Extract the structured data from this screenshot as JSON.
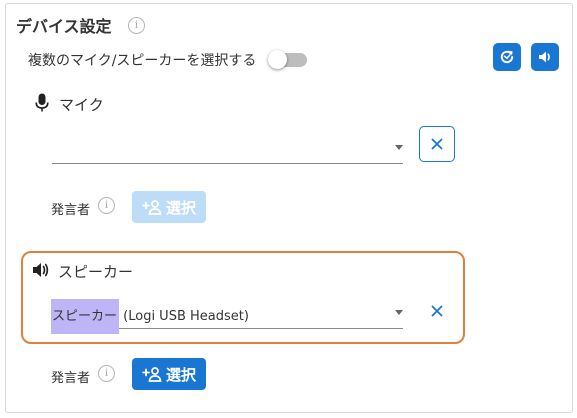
{
  "header": {
    "title": "デバイス設定",
    "info_icon": "info-icon"
  },
  "multi_select": {
    "label": "複数のマイク/スピーカーを選択する",
    "toggle_on": false
  },
  "toolbar": {
    "refresh_icon": "refresh-icon",
    "volume_icon": "volume-icon"
  },
  "microphone": {
    "label": "マイク",
    "icon": "microphone-icon",
    "selected_value": "",
    "clear_icon": "close-icon",
    "speaker_label": "発言者",
    "select_button_label": "選択",
    "select_button_enabled": false
  },
  "speaker": {
    "label": "スピーカー",
    "icon": "speaker-icon",
    "selected_value_prefix": "スピーカー",
    "selected_value_rest": " (Logi USB Headset)",
    "clear_icon": "close-icon",
    "speaker_label": "発言者",
    "select_button_label": "選択",
    "select_button_enabled": true
  },
  "colors": {
    "accent": "#1976d2",
    "accent_disabled": "#bcdcf7",
    "highlight_frame": "#e0803a",
    "text_highlight": "#bdb5f5"
  }
}
